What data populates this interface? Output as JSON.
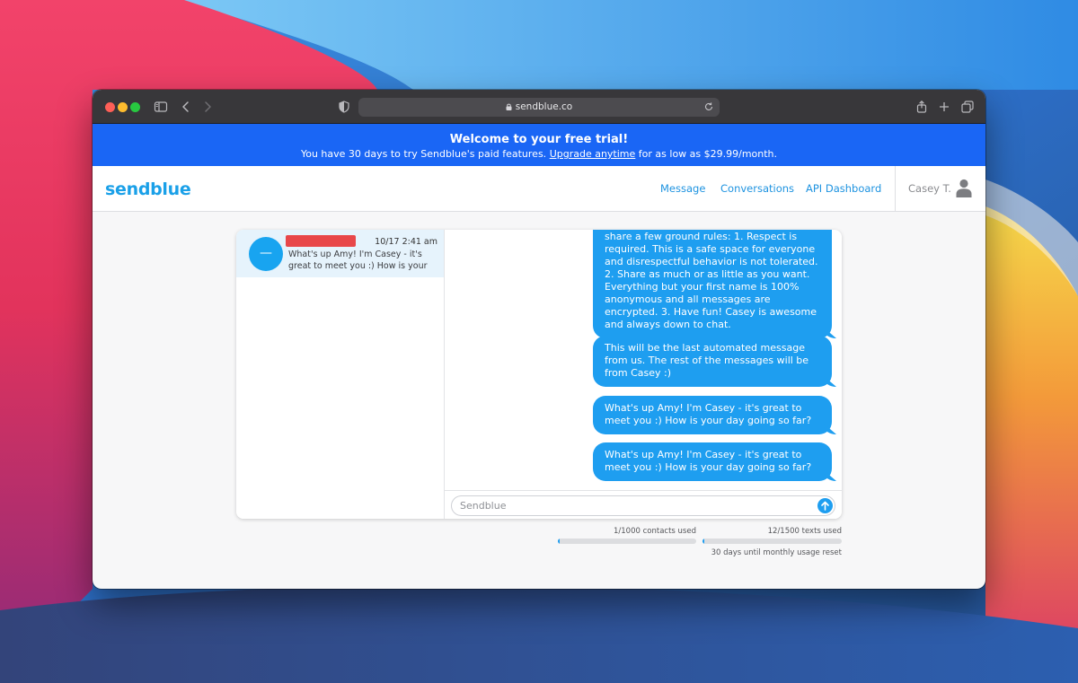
{
  "browser": {
    "url": "sendblue.co",
    "buttons": [
      "sidebar-toggle-icon",
      "back-icon",
      "forward-icon",
      "privacy-shield-icon",
      "reload-icon",
      "share-icon",
      "new-tab-icon",
      "tab-overview-icon"
    ]
  },
  "banner": {
    "title": "Welcome to your free trial!",
    "text_before": "You have 30 days to try Sendblue's paid features.",
    "link": "Upgrade anytime",
    "text_after": "for as low as $29.99/month."
  },
  "nav": {
    "logo": "sendblue",
    "links": [
      "Message",
      "Conversations",
      "API Dashboard"
    ],
    "user": "Casey T."
  },
  "conversations": [
    {
      "avatar_initial": "—",
      "time": "10/17 2:41 am",
      "preview": "What's up Amy! I'm Casey - it's great to meet you :) How is your day going"
    }
  ],
  "messages": [
    "We introduced you to Casey, I wanted to share a few ground rules: 1. Respect is required. This is a safe space for everyone and disrespectful behavior is not tolerated. 2. Share as much or as little as you want. Everything but your first name is 100% anonymous and all messages are encrypted. 3. Have fun! Casey is awesome and always down to chat.",
    "This will be the last automated message from us. The rest of the messages will be from Casey :)",
    "What's up Amy! I'm Casey - it's great to meet you :) How is your day going so far?",
    "What's up Amy! I'm Casey - it's great to meet you :) How is your day going so far?"
  ],
  "composer": {
    "placeholder": "Sendblue"
  },
  "usage": {
    "contacts_label": "1/1000 contacts used",
    "contacts_fraction": 0.001,
    "texts_label": "12/1500 texts used",
    "texts_fraction": 0.008,
    "reset_label": "30 days until monthly usage reset"
  },
  "colors": {
    "accent": "#1e9ef0",
    "banner": "#1a66f5",
    "redaction": "#e8474a"
  }
}
